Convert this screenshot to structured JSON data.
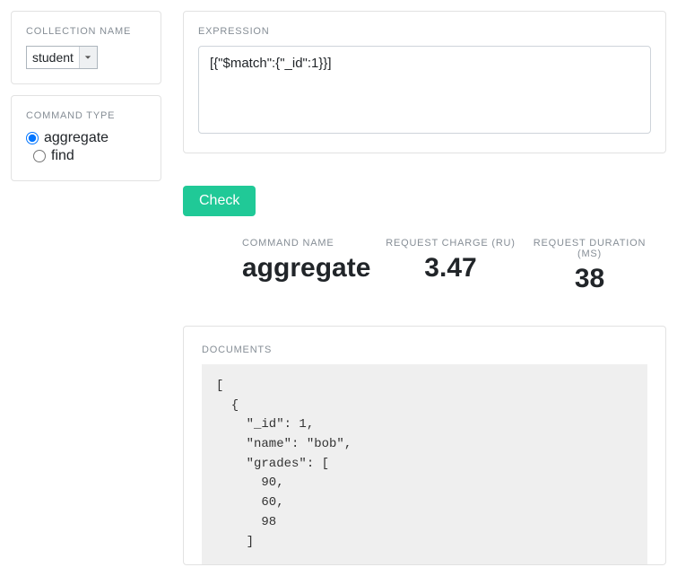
{
  "sidebar": {
    "collection_name_label": "COLLECTION NAME",
    "collection_value": "student",
    "command_type_label": "COMMAND TYPE",
    "radios": {
      "aggregate": "aggregate",
      "find": "find"
    },
    "selected_command": "aggregate"
  },
  "expression": {
    "label": "EXPRESSION",
    "value": "[{\"$match\":{\"_id\":1}}]"
  },
  "check_button": "Check",
  "stats": {
    "command_name": {
      "label": "COMMAND NAME",
      "value": "aggregate"
    },
    "request_charge": {
      "label": "REQUEST CHARGE (RU)",
      "value": "3.47"
    },
    "request_duration": {
      "label": "REQUEST DURATION (MS)",
      "value": "38"
    }
  },
  "documents": {
    "label": "DOCUMENTS",
    "text": "[\n  {\n    \"_id\": 1,\n    \"name\": \"bob\",\n    \"grades\": [\n      90,\n      60,\n      98\n    ]"
  }
}
